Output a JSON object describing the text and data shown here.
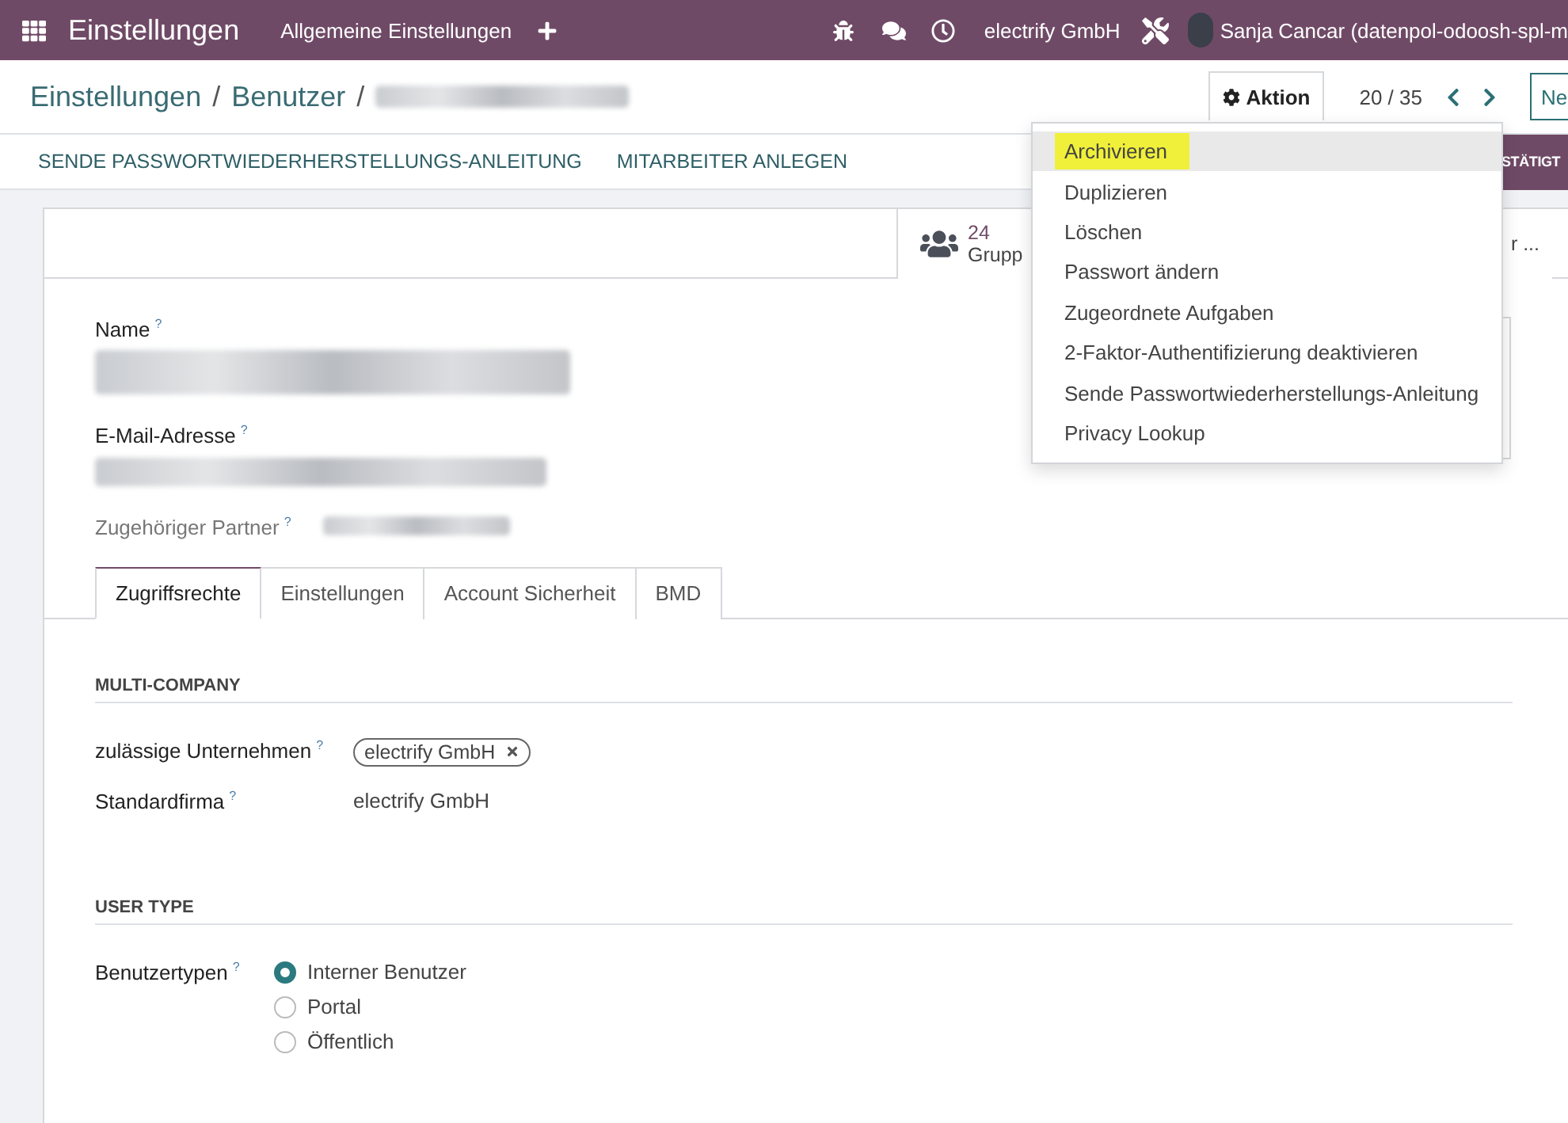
{
  "navbar": {
    "app_title": "Einstellungen",
    "menu_items": [
      "Allgemeine Einstellungen"
    ],
    "company": "electrify GmbH",
    "user": "Sanja Cancar (datenpol-odoosh-spl-m"
  },
  "breadcrumb_separator": "/",
  "breadcrumbs": [
    {
      "label": "Einstellungen"
    },
    {
      "label": "Benutzer"
    },
    {
      "redacted": true
    }
  ],
  "action_button": "Aktion",
  "pager": "20 / 35",
  "new_button": "Ne",
  "header_buttons": [
    "SENDE PASSWORTWIEDERHERSTELLUNGS-ANLEITUNG",
    "MITARBEITER ANLEGEN"
  ],
  "status_button": "STÄTIGT",
  "smart_buttons": [
    {
      "count": "24",
      "label": "Grupp"
    },
    {
      "label": "r ..."
    }
  ],
  "help_mark": "?",
  "fields": [
    {
      "label": "Name",
      "kind": "title",
      "redacted": true
    },
    {
      "label": "E-Mail-Adresse",
      "kind": "title",
      "redacted": true
    },
    {
      "label": "Zugehöriger Partner",
      "kind": "inline",
      "redacted": true
    }
  ],
  "tabs": [
    {
      "label": "Zugriffsrechte",
      "selected": true
    },
    {
      "label": "Einstellungen",
      "selected": false
    },
    {
      "label": "Account Sicherheit",
      "selected": false
    },
    {
      "label": "BMD",
      "selected": false
    }
  ],
  "sections": [
    {
      "title": "MULTI-COMPANY",
      "rows": [
        {
          "label": "zulässige Unternehmen",
          "kind": "tags",
          "tags": [
            "electrify GmbH"
          ]
        },
        {
          "label": "Standardfirma",
          "kind": "text",
          "value": "electrify GmbH"
        }
      ]
    },
    {
      "title": "USER TYPE",
      "rows": [
        {
          "label": "Benutzertypen",
          "kind": "radio",
          "options": [
            {
              "label": "Interner Benutzer",
              "selected": true
            },
            {
              "label": "Portal",
              "selected": false
            },
            {
              "label": "Öffentlich",
              "selected": false
            }
          ]
        }
      ]
    }
  ],
  "action_menu": [
    {
      "label": "Archivieren",
      "highlighted": true
    },
    {
      "label": "Duplizieren",
      "highlighted": false
    },
    {
      "label": "Löschen",
      "highlighted": false
    },
    {
      "label": "Passwort ändern",
      "highlighted": false
    },
    {
      "label": "Zugeordnete Aufgaben",
      "highlighted": false
    },
    {
      "label": "2-Faktor-Authentifizierung deaktivieren",
      "highlighted": false
    },
    {
      "label": "Sende Passwortwiederherstellungs-Anleitung",
      "highlighted": false
    },
    {
      "label": "Privacy Lookup",
      "highlighted": false
    }
  ]
}
